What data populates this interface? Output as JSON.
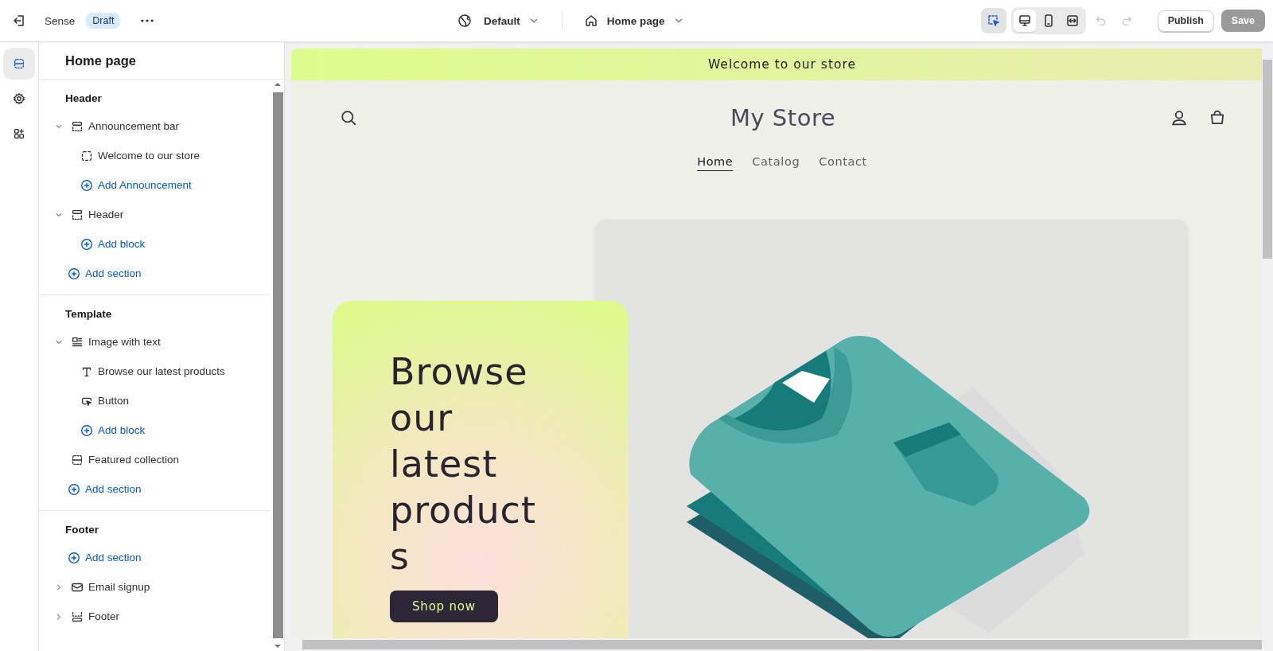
{
  "topbar": {
    "theme_name": "Sense",
    "status_badge": "Draft",
    "theme_selector": "Default",
    "page_selector": "Home page",
    "inspector": {
      "selected": true
    },
    "devices": [
      {
        "kind": "desktop",
        "selected": true
      },
      {
        "kind": "mobile",
        "selected": false
      },
      {
        "kind": "fullwidth",
        "selected": false
      }
    ],
    "history": [
      {
        "kind": "undo",
        "disabled": true
      },
      {
        "kind": "redo",
        "disabled": true
      }
    ],
    "publish_button": "Publish",
    "save_button": {
      "label": "Save",
      "disabled": true
    }
  },
  "rail": [
    {
      "kind": "sections",
      "selected": true
    },
    {
      "kind": "settings",
      "selected": false
    },
    {
      "kind": "apps",
      "selected": false
    }
  ],
  "panel": {
    "title": "Home page",
    "groups": [
      {
        "title": "Header",
        "items": [
          {
            "kind": "announcement",
            "label": "Announcement bar",
            "expanded": true,
            "children": [
              {
                "kind": "block",
                "label": "Welcome to our store"
              },
              {
                "kind": "add",
                "label": "Add Announcement"
              }
            ]
          },
          {
            "kind": "header",
            "label": "Header",
            "expanded": true,
            "children": [
              {
                "kind": "add",
                "label": "Add block"
              }
            ]
          },
          {
            "kind": "add",
            "label": "Add section"
          }
        ]
      },
      {
        "title": "Template",
        "items": [
          {
            "kind": "imagetext",
            "label": "Image with text",
            "expanded": true,
            "children": [
              {
                "kind": "text",
                "label": "Browse our latest products"
              },
              {
                "kind": "button",
                "label": "Button"
              },
              {
                "kind": "add",
                "label": "Add block"
              }
            ]
          },
          {
            "kind": "collection",
            "label": "Featured collection"
          },
          {
            "kind": "add",
            "label": "Add section"
          }
        ]
      },
      {
        "title": "Footer",
        "items": [
          {
            "kind": "add",
            "label": "Add section"
          },
          {
            "kind": "email",
            "label": "Email signup",
            "expanded": false
          },
          {
            "kind": "footer",
            "label": "Footer",
            "expanded": false
          }
        ]
      }
    ]
  },
  "preview": {
    "announcement": "Welcome to our store",
    "store_name": "My Store",
    "nav": [
      {
        "label": "Home",
        "selected": true
      },
      {
        "label": "Catalog",
        "selected": false
      },
      {
        "label": "Contact",
        "selected": false
      }
    ],
    "hero": {
      "heading": "Browse our latest products",
      "button": "Shop now"
    }
  }
}
